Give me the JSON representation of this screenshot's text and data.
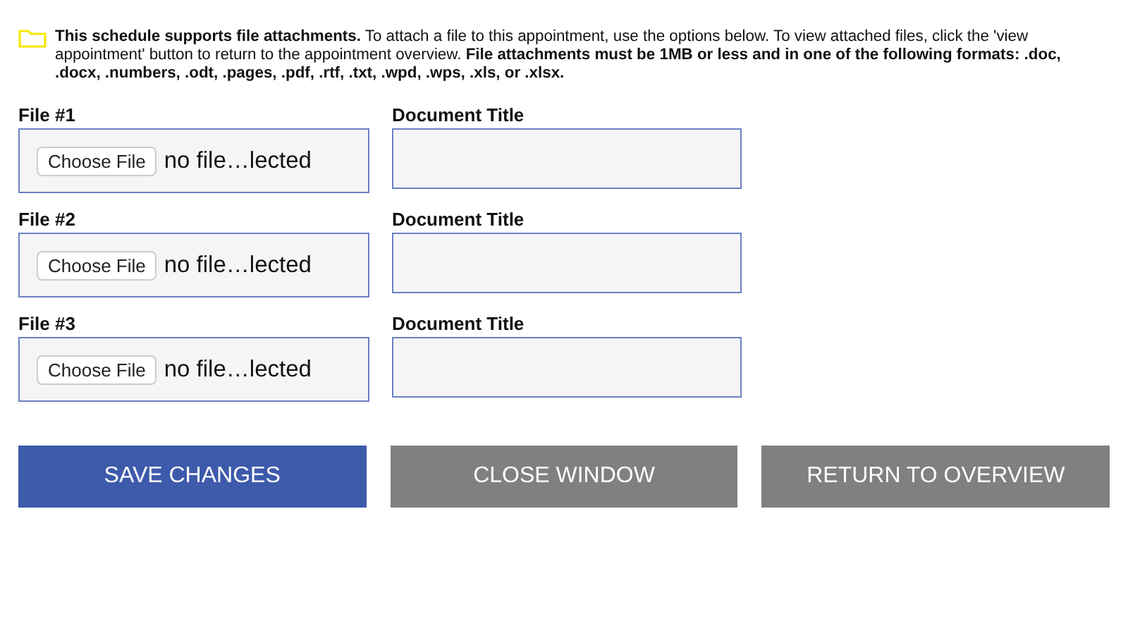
{
  "notice": "**This schedule supports file attachments.** To attach a file to this appointment, use the options below. To view attached files, click the 'view appointment' button to return to the appointment overview. **File attachments must be 1MB or less and in one of the following formats: .doc, .docx, .numbers, .odt, .pages, .pdf, .rtf, .txt, .wpd, .wps, .xls, or .xlsx.**",
  "files": [
    {
      "label": "File #1",
      "button": "Choose File",
      "status": "no file…lected",
      "title_label": "Document Title"
    },
    {
      "label": "File #2",
      "button": "Choose File",
      "status": "no file…lected",
      "title_label": "Document Title"
    },
    {
      "label": "File #3",
      "button": "Choose File",
      "status": "no file…lected",
      "title_label": "Document Title"
    }
  ],
  "buttons": [
    {
      "label": "SAVE CHANGES",
      "kind": "primary"
    },
    {
      "label": "CLOSE WINDOW",
      "kind": "secondary"
    },
    {
      "label": "RETURN TO OVERVIEW",
      "kind": "secondary"
    }
  ]
}
